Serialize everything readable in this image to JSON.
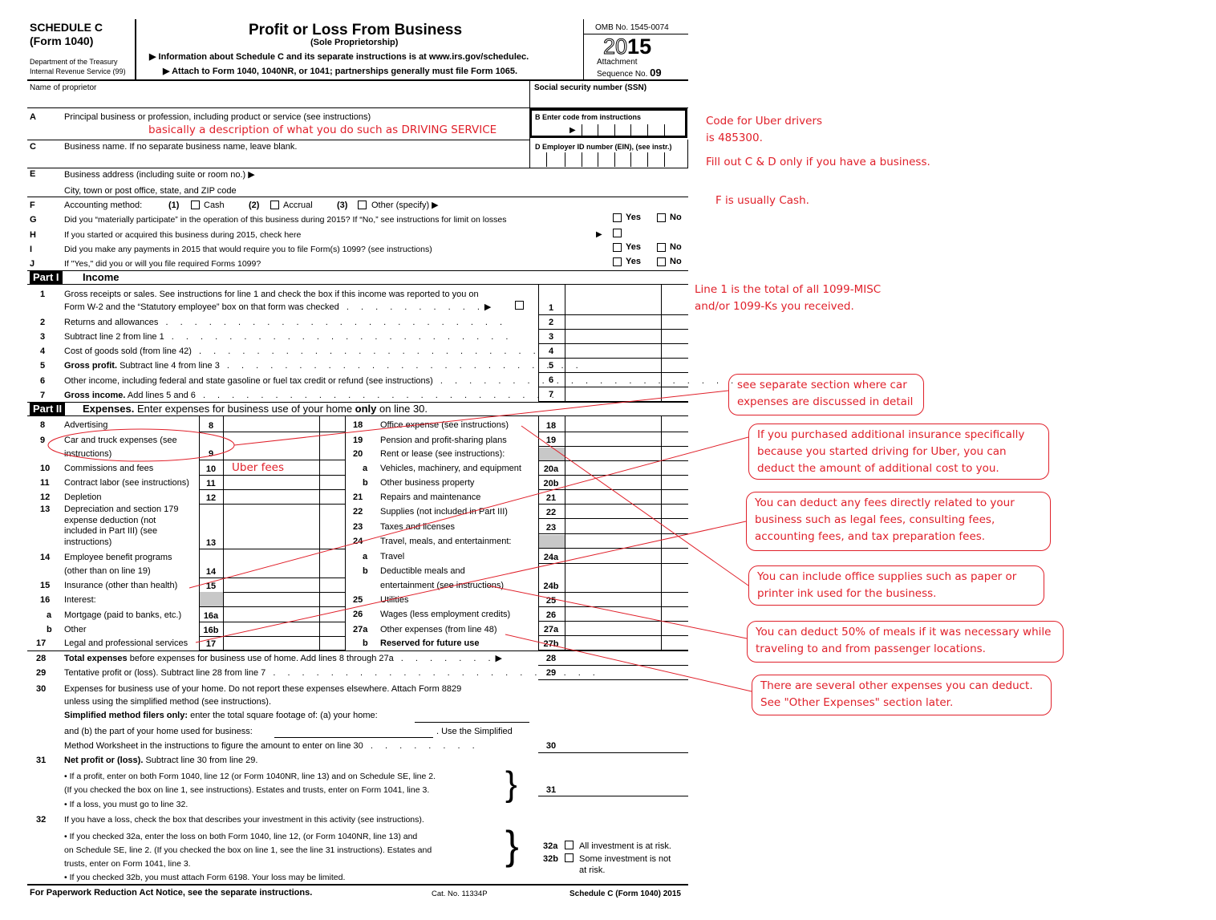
{
  "header": {
    "form_name": "SCHEDULE C",
    "form_sub": "(Form 1040)",
    "dept1": "Department of the Treasury",
    "dept2": "Internal Revenue Service (99)",
    "title": "Profit or Loss From Business",
    "subtitle": "(Sole Proprietorship)",
    "info_line": "▶ Information about Schedule C and its separate instructions is at www.irs.gov/schedulec.",
    "attach_line": "▶ Attach to Form 1040, 1040NR, or 1041; partnerships generally must file Form 1065.",
    "omb": "OMB No. 1545-0074",
    "year_outline": "20",
    "year_bold": "15",
    "attachment": "Attachment",
    "sequence_label": "Sequence No.",
    "sequence_no": "09"
  },
  "top_fields": {
    "name_label": "Name of proprietor",
    "ssn_label": "Social security number (SSN)",
    "A_letter": "A",
    "A_label": "Principal business or profession, including product or service (see instructions)",
    "A_value": "basically a description of what you do such as DRIVING SERVICE",
    "B_label": "B  Enter code from instructions",
    "C_letter": "C",
    "C_label": "Business name. If no separate business name, leave blank.",
    "D_label": "D  Employer ID number (EIN), (see instr.)",
    "E_letter": "E",
    "E_label": "Business address (including suite or room no.) ▶",
    "E_city": "City, town or post office, state, and ZIP code"
  },
  "questions": {
    "F_letter": "F",
    "F_label": "Accounting method:",
    "F_opt1_num": "(1)",
    "F_opt1": "Cash",
    "F_opt2_num": "(2)",
    "F_opt2": "Accrual",
    "F_opt3_num": "(3)",
    "F_opt3": "Other (specify) ▶",
    "G_letter": "G",
    "G_label": "Did you “materially participate” in the operation of this business during 2015? If “No,” see instructions for limit on losses",
    "H_letter": "H",
    "H_label": "If you started or acquired this business during 2015, check here",
    "I_letter": "I",
    "I_label": "Did you make any payments in 2015 that would require you to file Form(s) 1099? (see instructions)",
    "J_letter": "J",
    "J_label": "If \"Yes,\" did you or will you file required Forms 1099?",
    "yes": "Yes",
    "no": "No"
  },
  "part1": {
    "tag": "Part I",
    "title": "Income",
    "lines": [
      {
        "num": "1",
        "text": "Gross receipts or sales. See instructions for line 1 and check the box if this income was reported to you on",
        "text2": "Form W-2 and the “Statutory employee” box on that form was checked",
        "box": "1"
      },
      {
        "num": "2",
        "text": "Returns and allowances",
        "box": "2"
      },
      {
        "num": "3",
        "text": "Subtract line 2 from line 1",
        "box": "3"
      },
      {
        "num": "4",
        "text": "Cost of goods sold (from line 42)",
        "box": "4"
      },
      {
        "num": "5",
        "bold": "Gross profit.",
        "text": "Subtract line 4 from line 3",
        "box": "5"
      },
      {
        "num": "6",
        "text": "Other income, including federal and state gasoline or fuel tax credit or refund (see instructions)",
        "box": "6"
      },
      {
        "num": "7",
        "bold": "Gross income.",
        "text": "Add lines 5 and 6",
        "box": "7"
      }
    ]
  },
  "part2": {
    "tag": "Part II",
    "title_bold": "Expenses.",
    "title_rest": "Enter expenses for business use of your home",
    "title_only": "only",
    "title_end": "on line 30.",
    "left": [
      {
        "num": "8",
        "text": "Advertising",
        "box": "8"
      },
      {
        "num": "9",
        "text": "Car and truck expenses (see",
        "text2": "instructions)",
        "box": "9"
      },
      {
        "num": "10",
        "text": "Commissions and fees",
        "box": "10",
        "value": "Uber fees"
      },
      {
        "num": "11",
        "text": "Contract labor (see instructions)",
        "box": "11"
      },
      {
        "num": "12",
        "text": "Depletion",
        "box": "12"
      },
      {
        "num": "13",
        "text": "Depreciation and section 179",
        "text2": "expense deduction (not",
        "text3": "included in Part III) (see",
        "text4": "instructions)",
        "box": "13"
      },
      {
        "num": "14",
        "text": "Employee benefit programs",
        "text2": "(other than on line 19)",
        "box": "14"
      },
      {
        "num": "15",
        "text": "Insurance (other than health)",
        "box": "15"
      },
      {
        "num": "16",
        "text": "Interest:",
        "box": ""
      },
      {
        "num": "a",
        "text": "Mortgage (paid to banks, etc.)",
        "box": "16a"
      },
      {
        "num": "b",
        "text": "Other",
        "box": "16b"
      },
      {
        "num": "17",
        "text": "Legal and professional services",
        "box": "17"
      }
    ],
    "right": [
      {
        "num": "18",
        "text": "Office expense (see instructions)",
        "box": "18"
      },
      {
        "num": "19",
        "text": "Pension and profit-sharing plans",
        "box": "19"
      },
      {
        "num": "20",
        "text": "Rent or lease (see instructions):",
        "box": ""
      },
      {
        "num": "a",
        "text": "Vehicles, machinery, and equipment",
        "box": "20a"
      },
      {
        "num": "b",
        "text": "Other business property",
        "box": "20b"
      },
      {
        "num": "21",
        "text": "Repairs and maintenance",
        "box": "21"
      },
      {
        "num": "22",
        "text": "Supplies (not included in Part III)",
        "box": "22"
      },
      {
        "num": "23",
        "text": "Taxes and licenses",
        "box": "23"
      },
      {
        "num": "24",
        "text": "Travel, meals, and entertainment:",
        "box": ""
      },
      {
        "num": "a",
        "text": "Travel",
        "box": "24a"
      },
      {
        "num": "b",
        "text": "Deductible meals and",
        "text2": "entertainment (see instructions)",
        "box": "24b"
      },
      {
        "num": "25",
        "text": "Utilities",
        "box": "25"
      },
      {
        "num": "26",
        "text": "Wages (less employment credits)",
        "box": "26"
      },
      {
        "num": "27a",
        "text": "Other expenses (from line 48)",
        "box": "27a"
      },
      {
        "num": "b",
        "text": "Reserved for future use",
        "box": "27b",
        "bold_text": true
      }
    ]
  },
  "bottom": {
    "l28_num": "28",
    "l28_bold": "Total expenses",
    "l28_text": "before expenses for business use of home. Add lines 8 through 27a",
    "l28_box": "28",
    "l29_num": "29",
    "l29_text": "Tentative profit or (loss). Subtract line 28 from line 7",
    "l29_box": "29",
    "l30_num": "30",
    "l30_text1": "Expenses for business use of your home. Do not report these expenses elsewhere. Attach Form 8829",
    "l30_text2": "unless using the simplified method (see instructions).",
    "l30_bold3": "Simplified method filers only:",
    "l30_text3": "enter the total square footage of: (a) your home:",
    "l30_text4a": "and (b) the part of your home used for business:",
    "l30_text4b": ". Use the Simplified",
    "l30_text5": "Method Worksheet in the instructions to figure the amount to enter on line 30",
    "l30_box": "30",
    "l31_num": "31",
    "l31_bold": "Net profit or (loss).",
    "l31_text": "Subtract line 30 from line 29.",
    "l31_b1": "• If a profit, enter on both Form 1040, line 12 (or Form 1040NR, line 13) and on Schedule SE, line 2.",
    "l31_b1b": "(If you checked the box on line 1, see instructions). Estates and trusts, enter on Form 1041, line 3.",
    "l31_b2": "• If a loss, you must  go to line 32.",
    "l31_box": "31",
    "l32_num": "32",
    "l32_text": "If you have a loss, check the box that describes your investment in this activity (see instructions).",
    "l32_b1": "•  If you checked 32a, enter the loss on both Form 1040, line 12, (or Form 1040NR, line 13) and",
    "l32_b1b": "on Schedule SE, line 2. (If you checked the box on line 1, see the line 31 instructions). Estates and",
    "l32_b1c": "trusts, enter on Form 1041, line 3.",
    "l32_b2": "•  If you checked 32b, you must attach Form 6198. Your loss may be limited.",
    "l32a": "32a",
    "l32a_text": "All investment is at risk.",
    "l32b": "32b",
    "l32b_text": "Some investment is not",
    "l32b_text2": "at risk.",
    "footer_left": "For Paperwork Reduction Act Notice, see the separate instructions.",
    "footer_cat": "Cat. No. 11334P",
    "footer_right": "Schedule C (Form 1040) 2015"
  },
  "annotations": {
    "code_note1": "Code for Uber drivers",
    "code_note2": "is 485300.",
    "cd_note": "Fill out C & D only if you have a business.",
    "f_note": "F is usually Cash.",
    "line1_note1": "Line 1 is the total of all 1099-MISC",
    "line1_note2": "and/or 1099-Ks you received.",
    "car_bubble1": "see separate section where car",
    "car_bubble2": "expenses are discussed in detail",
    "ins_bubble1": "If you purchased additional insurance specifically",
    "ins_bubble2": "because you started driving for Uber, you can",
    "ins_bubble3": "deduct the amount of additional cost to you.",
    "legal_bubble1": "You can deduct any fees directly related to your",
    "legal_bubble2": "business such as legal fees, consulting fees,",
    "legal_bubble3": "accounting fees, and tax preparation fees.",
    "office_bubble1": "You can include office supplies such as paper or",
    "office_bubble2": "printer ink used for the business.",
    "meals_bubble1": "You can deduct 50% of meals if it was necessary while",
    "meals_bubble2": "traveling to and from passenger locations.",
    "other_bubble1": "There are several other expenses you can deduct.",
    "other_bubble2": "See \"Other Expenses\" section later.",
    "accent_color": "#e0202a"
  }
}
